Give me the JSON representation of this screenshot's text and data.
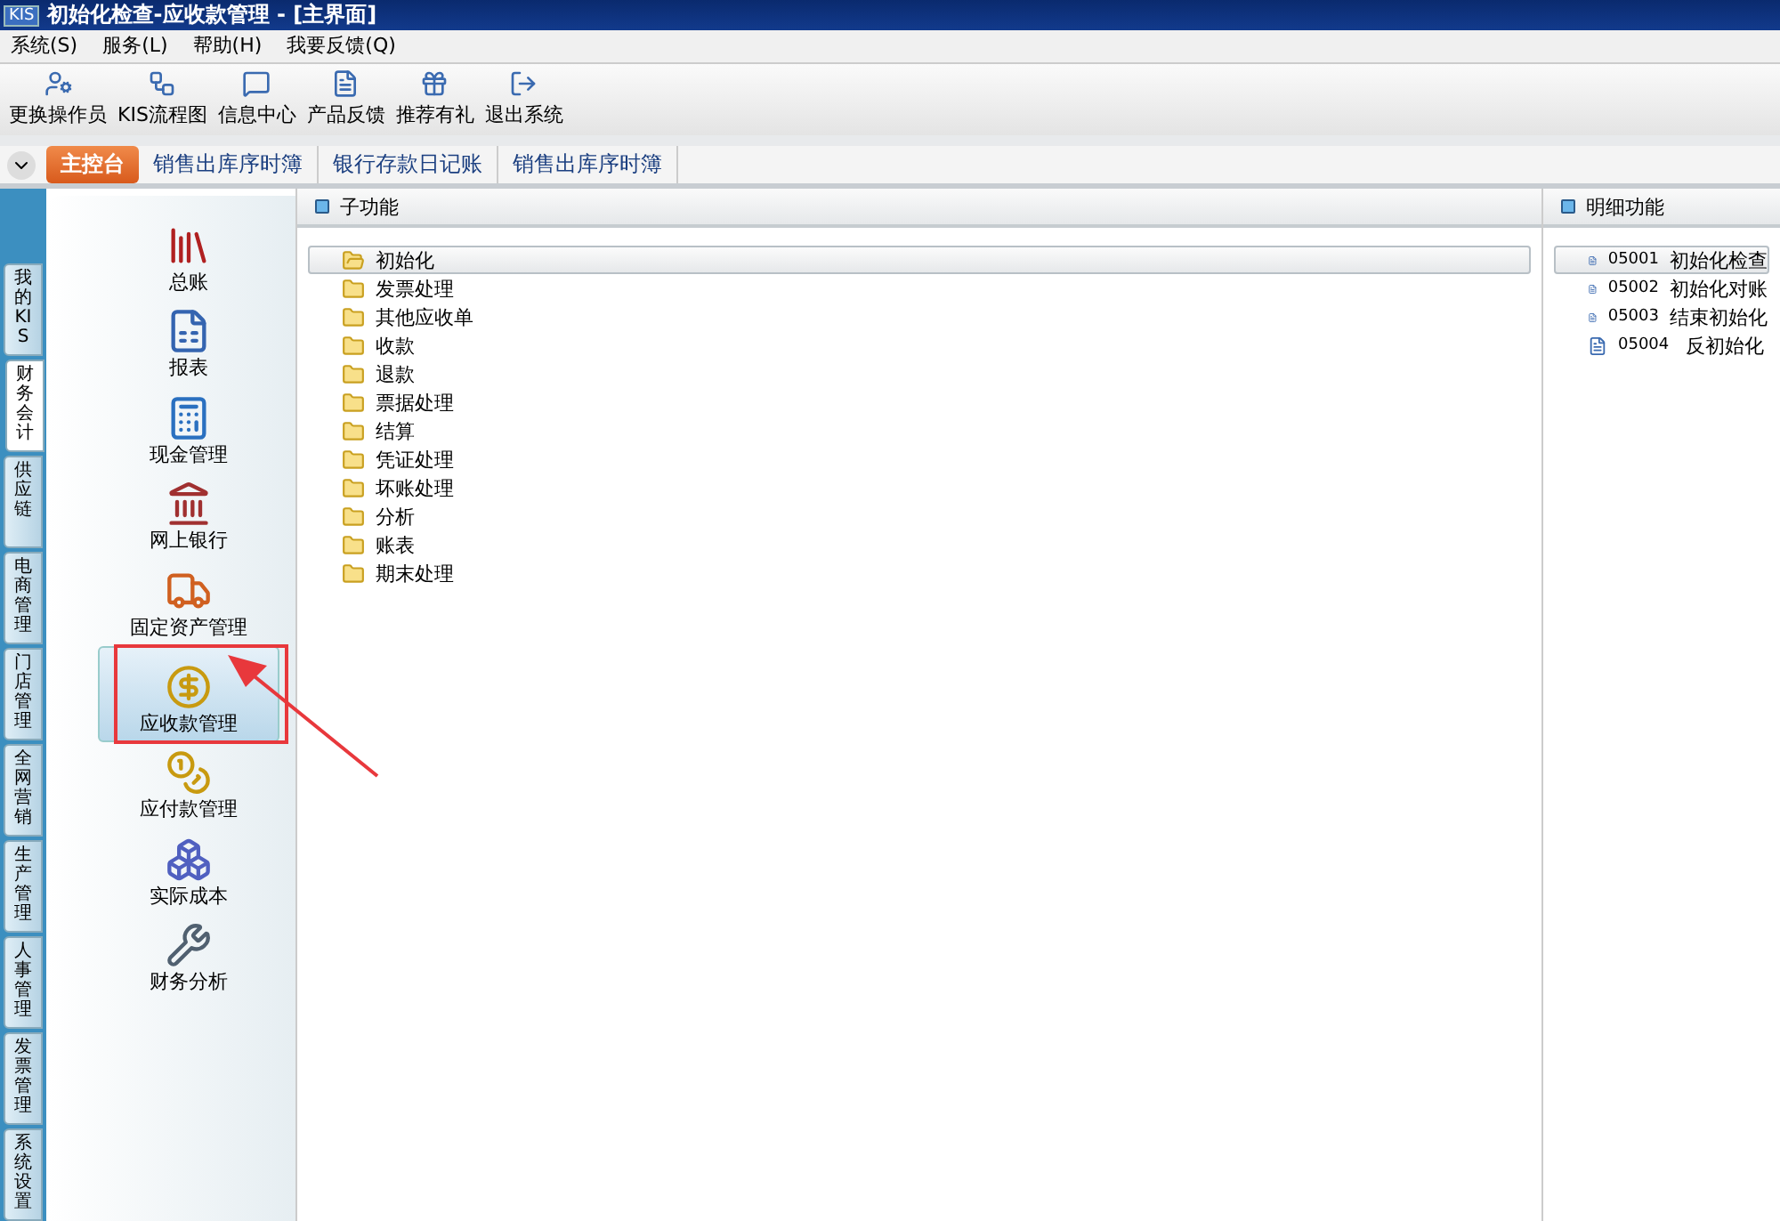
{
  "window": {
    "badge": "KIS",
    "title": "初始化检查-应收款管理 - [主界面]"
  },
  "menu": [
    "系统(S)",
    "服务(L)",
    "帮助(H)",
    "我要反馈(Q)"
  ],
  "toolbar": [
    "更换操作员",
    "KIS流程图",
    "信息中心",
    "产品反馈",
    "推荐有礼",
    "退出系统"
  ],
  "tabs": [
    {
      "label": "主控台",
      "selected": true
    },
    {
      "label": "销售出库序时簿",
      "selected": false
    },
    {
      "label": "银行存款日记账",
      "selected": false
    },
    {
      "label": "销售出库序时簿",
      "selected": false
    }
  ],
  "side_tabs": [
    {
      "label": "我的KIS",
      "selected": false
    },
    {
      "label": "财务会计",
      "selected": true
    },
    {
      "label": "供应链",
      "selected": false
    },
    {
      "label": "电商管理",
      "selected": false
    },
    {
      "label": "门店管理",
      "selected": false
    },
    {
      "label": "全网营销",
      "selected": false
    },
    {
      "label": "生产管理",
      "selected": false
    },
    {
      "label": "人事管理",
      "selected": false
    },
    {
      "label": "发票管理",
      "selected": false
    },
    {
      "label": "系统设置",
      "selected": false
    }
  ],
  "modules": [
    {
      "label": "总账",
      "selected": false
    },
    {
      "label": "报表",
      "selected": false
    },
    {
      "label": "现金管理",
      "selected": false
    },
    {
      "label": "网上银行",
      "selected": false
    },
    {
      "label": "固定资产管理",
      "selected": false
    },
    {
      "label": "应收款管理",
      "selected": true
    },
    {
      "label": "应付款管理",
      "selected": false
    },
    {
      "label": "实际成本",
      "selected": false
    },
    {
      "label": "财务分析",
      "selected": false
    }
  ],
  "sub_functions": {
    "title": "子功能",
    "items": [
      {
        "label": "初始化",
        "selected": true
      },
      {
        "label": "发票处理",
        "selected": false
      },
      {
        "label": "其他应收单",
        "selected": false
      },
      {
        "label": "收款",
        "selected": false
      },
      {
        "label": "退款",
        "selected": false
      },
      {
        "label": "票据处理",
        "selected": false
      },
      {
        "label": "结算",
        "selected": false
      },
      {
        "label": "凭证处理",
        "selected": false
      },
      {
        "label": "坏账处理",
        "selected": false
      },
      {
        "label": "分析",
        "selected": false
      },
      {
        "label": "账表",
        "selected": false
      },
      {
        "label": "期末处理",
        "selected": false
      }
    ]
  },
  "detail_functions": {
    "title": "明细功能",
    "items": [
      {
        "code": "05001",
        "label": "初始化检查",
        "selected": true
      },
      {
        "code": "05002",
        "label": "初始化对账",
        "selected": false
      },
      {
        "code": "05003",
        "label": "结束初始化",
        "selected": false
      },
      {
        "code": "05004",
        "label": "反初始化",
        "selected": false
      }
    ]
  }
}
